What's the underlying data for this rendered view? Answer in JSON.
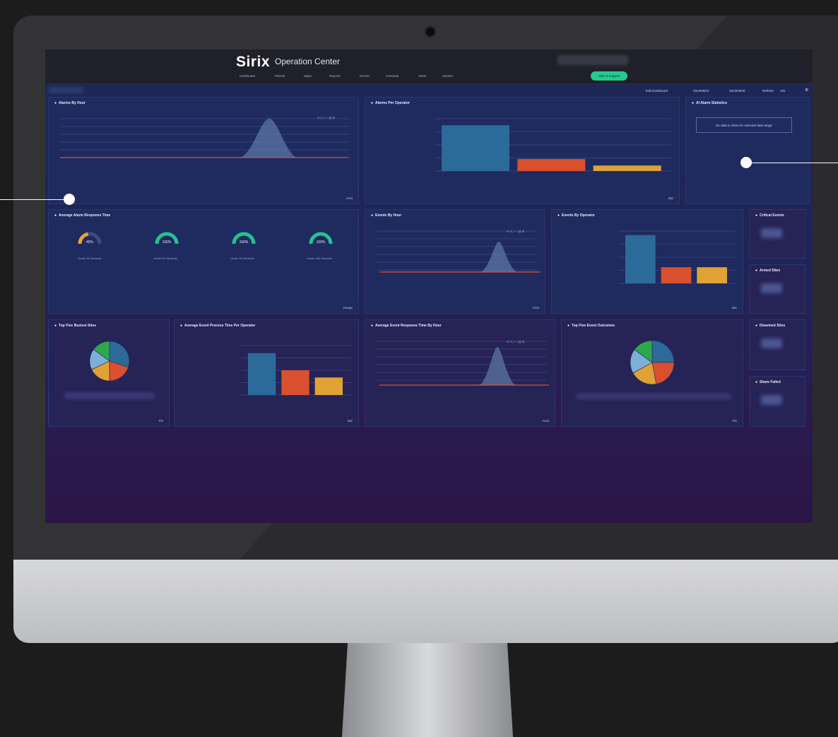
{
  "app": {
    "brand": "Sirix",
    "subtitle": "Operation Center",
    "nav": [
      "Dashboard",
      "Patrols",
      "Maps",
      "Reports",
      "Events",
      "Cameras",
      "Alerts",
      "System"
    ],
    "cta": "Alert & Support",
    "toolbar": {
      "edit": "Edit Dashboard",
      "date_from": "2023/09/01",
      "date_to": "2023/09/26",
      "refresh_label": "Refresh",
      "refresh_value": "10s"
    }
  },
  "panels": {
    "alarms_by_hour": {
      "title": "Alarms By Hour",
      "control": "Area"
    },
    "alarms_per_operator": {
      "title": "Alarms Per Operator",
      "control": "Bar"
    },
    "ai_alarm_stats": {
      "title": "AI Alarm Statistics",
      "nodata": "No data to show for selected date range"
    },
    "avg_alarm_response": {
      "title": "Average Alarm Response Time",
      "control": "Gauge",
      "gauges": [
        {
          "value": "45%",
          "label": "Under 30 Seconds",
          "color": "#e8a33a"
        },
        {
          "value": "100%",
          "label": "Under 60 Seconds",
          "color": "#22c38e"
        },
        {
          "value": "100%",
          "label": "Under 90 Seconds",
          "color": "#22c38e"
        },
        {
          "value": "100%",
          "label": "Under 180 Seconds",
          "color": "#22c38e"
        }
      ]
    },
    "events_by_hour": {
      "title": "Events By Hour",
      "control": "Area"
    },
    "events_by_operator": {
      "title": "Events By Operator",
      "control": "Bar"
    },
    "critical_events": {
      "title": "Critical Events"
    },
    "armed_sites": {
      "title": "Armed Sites"
    },
    "top_five_busiest": {
      "title": "Top Five Busiest Sites",
      "control": "Pie"
    },
    "avg_event_process": {
      "title": "Average Event Process Time Per Operator",
      "control": "Bar"
    },
    "avg_event_response_hour": {
      "title": "Average Event Response Time By Hour",
      "control": "Area"
    },
    "top_five_outcomes": {
      "title": "Top Five Event Outcomes",
      "control": "Pie"
    },
    "disarmed_sites": {
      "title": "Disarmed Sites"
    },
    "share_failed": {
      "title": "Share Failed"
    }
  },
  "colors": {
    "blue": "#2c6a9a",
    "orange": "#d9502e",
    "amber": "#e0a234",
    "green": "#22c38e",
    "lineRed": "#e0502e",
    "peak": "#5f7aa8"
  },
  "charts": {
    "alarms_per_operator": {
      "type": "bar",
      "values": [
        42,
        11,
        5
      ]
    },
    "events_by_operator": {
      "type": "bar",
      "values": [
        48,
        16,
        16
      ]
    },
    "avg_event_process": {
      "type": "bar",
      "values": [
        220,
        130,
        92
      ]
    },
    "top_five_busiest": {
      "type": "pie",
      "values": [
        30,
        20,
        18,
        17,
        15
      ],
      "colors": [
        "#2c6a9a",
        "#d9502e",
        "#e0a234",
        "#7db0d8",
        "#2fa64a"
      ]
    },
    "top_five_outcomes": {
      "type": "pie",
      "values": [
        25,
        22,
        20,
        18,
        15
      ],
      "colors": [
        "#2c6a9a",
        "#d9502e",
        "#e0a234",
        "#7db0d8",
        "#2fa64a"
      ]
    }
  }
}
